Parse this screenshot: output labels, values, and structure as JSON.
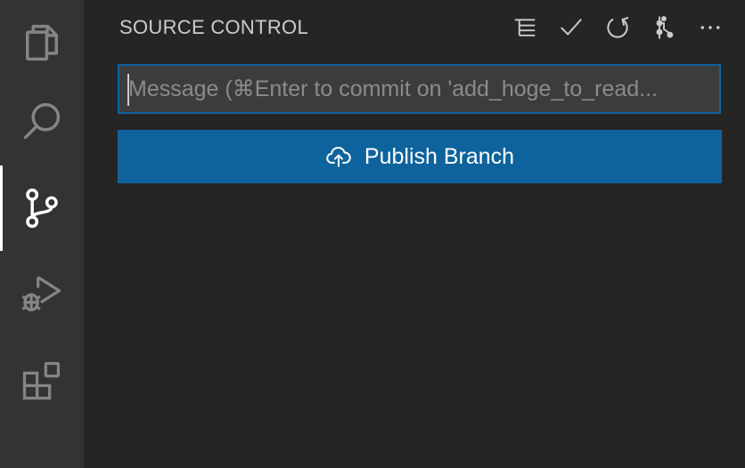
{
  "activity_bar": {
    "items": [
      {
        "name": "explorer",
        "icon": "files-icon"
      },
      {
        "name": "search",
        "icon": "search-icon"
      },
      {
        "name": "source-control",
        "icon": "source-control-icon",
        "active": true
      },
      {
        "name": "run-and-debug",
        "icon": "run-debug-icon"
      },
      {
        "name": "extensions",
        "icon": "extensions-icon"
      }
    ]
  },
  "sidebar": {
    "title": "SOURCE CONTROL",
    "actions": [
      {
        "icon": "view-as-tree-icon"
      },
      {
        "icon": "commit-check-icon"
      },
      {
        "icon": "refresh-icon"
      },
      {
        "icon": "branch-graph-icon"
      },
      {
        "icon": "more-actions-icon"
      }
    ],
    "commit_message": {
      "value": "",
      "placeholder": "Message (⌘Enter to commit on 'add_hoge_to_read..."
    },
    "publish_button": {
      "label": "Publish Branch",
      "icon": "cloud-upload-icon"
    }
  },
  "colors": {
    "activity_bar_bg": "#333333",
    "sidebar_bg": "#252526",
    "accent_blue": "#0e639c",
    "icon_color": "#858585",
    "active_icon_color": "#ffffff"
  }
}
